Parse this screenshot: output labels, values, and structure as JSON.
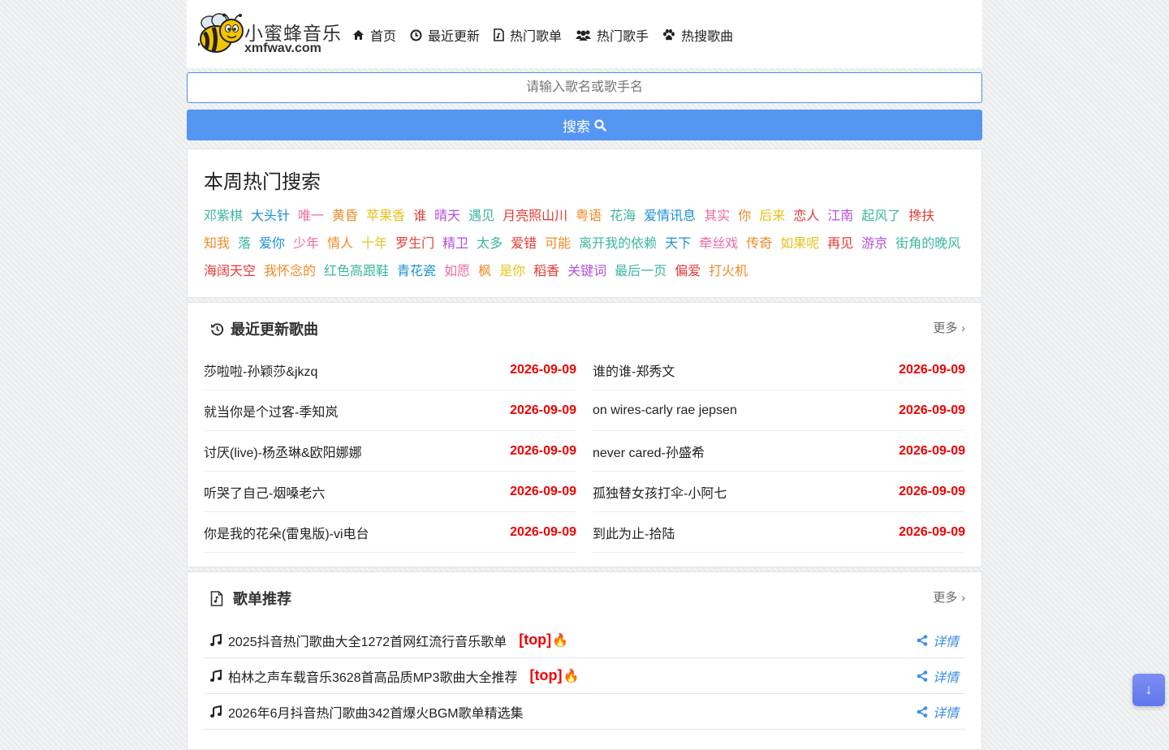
{
  "brand": {
    "name": "小蜜蜂音乐",
    "domain": "xmfwav.com"
  },
  "nav": [
    {
      "label": "首页",
      "icon": "home-icon"
    },
    {
      "label": "最近更新",
      "icon": "clock-icon"
    },
    {
      "label": "热门歌单",
      "icon": "file-audio-icon"
    },
    {
      "label": "热门歌手",
      "icon": "users-icon"
    },
    {
      "label": "热搜歌曲",
      "icon": "paw-icon"
    }
  ],
  "search": {
    "placeholder": "请输入歌名或歌手名",
    "value": "",
    "button_label": "搜索"
  },
  "hot_search": {
    "title": "本周热门搜索",
    "tags": [
      {
        "text": "邓紫棋",
        "color": "#3cb6a0"
      },
      {
        "text": "大头针",
        "color": "#1a8fd6"
      },
      {
        "text": "唯一",
        "color": "#ef6ba0"
      },
      {
        "text": "黄昏",
        "color": "#f08a24"
      },
      {
        "text": "苹果香",
        "color": "#e6c21a"
      },
      {
        "text": "谁",
        "color": "#e53935"
      },
      {
        "text": "晴天",
        "color": "#b34fd8"
      },
      {
        "text": "遇见",
        "color": "#3cb6a0"
      },
      {
        "text": "月亮照山川",
        "color": "#e53935"
      },
      {
        "text": "粤语",
        "color": "#f08a24"
      },
      {
        "text": "花海",
        "color": "#3cb6a0"
      },
      {
        "text": "爱情讯息",
        "color": "#1a8fd6"
      },
      {
        "text": "其实",
        "color": "#ef6ba0"
      },
      {
        "text": "你",
        "color": "#f08a24"
      },
      {
        "text": "后来",
        "color": "#e6c21a"
      },
      {
        "text": "恋人",
        "color": "#e53935"
      },
      {
        "text": "江南",
        "color": "#b34fd8"
      },
      {
        "text": "起风了",
        "color": "#3cb6a0"
      },
      {
        "text": "搀扶",
        "color": "#e53935"
      },
      {
        "text": "知我",
        "color": "#f08a24"
      },
      {
        "text": "落",
        "color": "#3cb6a0"
      },
      {
        "text": "爱你",
        "color": "#1a8fd6"
      },
      {
        "text": "少年",
        "color": "#ef6ba0"
      },
      {
        "text": "情人",
        "color": "#f08a24"
      },
      {
        "text": "十年",
        "color": "#e6c21a"
      },
      {
        "text": "罗生门",
        "color": "#e53935"
      },
      {
        "text": "精卫",
        "color": "#b34fd8"
      },
      {
        "text": "太多",
        "color": "#3cb6a0"
      },
      {
        "text": "爱错",
        "color": "#e53935"
      },
      {
        "text": "可能",
        "color": "#f08a24"
      },
      {
        "text": "离开我的依赖",
        "color": "#3cb6a0"
      },
      {
        "text": "天下",
        "color": "#1a8fd6"
      },
      {
        "text": "牵丝戏",
        "color": "#ef6ba0"
      },
      {
        "text": "传奇",
        "color": "#f08a24"
      },
      {
        "text": "如果呢",
        "color": "#e6c21a"
      },
      {
        "text": "再见",
        "color": "#e53935"
      },
      {
        "text": "游京",
        "color": "#b34fd8"
      },
      {
        "text": "街角的晚风",
        "color": "#3cb6a0"
      },
      {
        "text": "海阔天空",
        "color": "#e53935"
      },
      {
        "text": "我怀念的",
        "color": "#f08a24"
      },
      {
        "text": "红色高跟鞋",
        "color": "#3cb6a0"
      },
      {
        "text": "青花瓷",
        "color": "#1a8fd6"
      },
      {
        "text": "如愿",
        "color": "#ef6ba0"
      },
      {
        "text": "枫",
        "color": "#f08a24"
      },
      {
        "text": "是你",
        "color": "#e6c21a"
      },
      {
        "text": "稻香",
        "color": "#e53935"
      },
      {
        "text": "关键词",
        "color": "#b34fd8"
      },
      {
        "text": "最后一页",
        "color": "#3cb6a0"
      },
      {
        "text": "偏爱",
        "color": "#e53935"
      },
      {
        "text": "打火机",
        "color": "#f08a24"
      }
    ]
  },
  "recent": {
    "title": "最近更新歌曲",
    "more_label": "更多",
    "left": [
      {
        "name": "莎啦啦-孙颖莎&jkzq",
        "date": "2026-09-09"
      },
      {
        "name": "就当你是个过客-季知岚",
        "date": "2026-09-09"
      },
      {
        "name": "讨厌(live)-杨丞琳&欧阳娜娜",
        "date": "2026-09-09"
      },
      {
        "name": "听哭了自己-烟嗓老六",
        "date": "2026-09-09"
      },
      {
        "name": "你是我的花朵(雷鬼版)-vi电台",
        "date": "2026-09-09"
      }
    ],
    "right": [
      {
        "name": "谁的谁-郑秀文",
        "date": "2026-09-09"
      },
      {
        "name": "on wires-carly rae jepsen",
        "date": "2026-09-09"
      },
      {
        "name": "never cared-孙盛希",
        "date": "2026-09-09"
      },
      {
        "name": "孤独替女孩打伞-小阿七",
        "date": "2026-09-09"
      },
      {
        "name": "到此为止-拾陆",
        "date": "2026-09-09"
      }
    ]
  },
  "playlists": {
    "title": "歌单推荐",
    "more_label": "更多",
    "detail_label": "详情",
    "items": [
      {
        "name": "2025抖音热门歌曲大全1272首网红流行音乐歌单",
        "badge": "[top]",
        "fire": "🔥"
      },
      {
        "name": "柏林之声车载音乐3628首高品质MP3歌曲大全推荐",
        "badge": "[top]",
        "fire": "🔥"
      },
      {
        "name": "2026年6月抖音热门歌曲342首爆火BGM歌单精选集",
        "badge": "",
        "fire": ""
      }
    ]
  },
  "float_button": {
    "label": "↓"
  }
}
